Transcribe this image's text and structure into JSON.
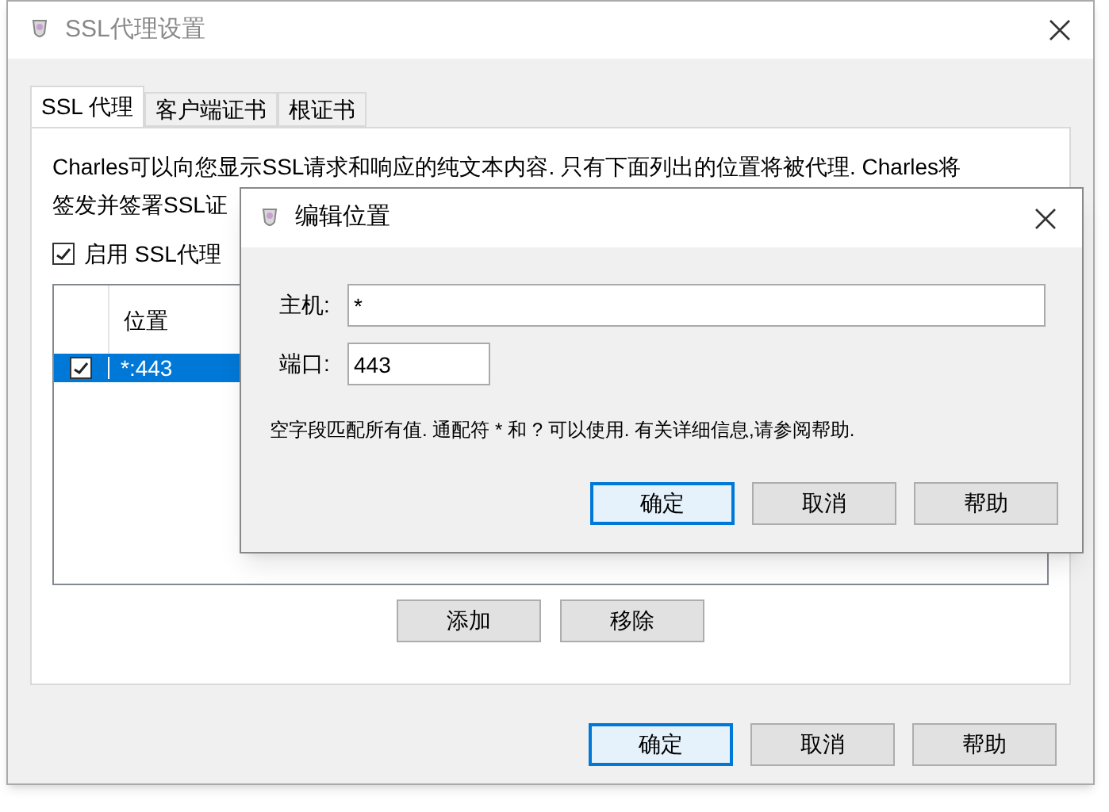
{
  "window": {
    "title": "SSL代理设置",
    "tabs": [
      {
        "label": "SSL 代理",
        "selected": true
      },
      {
        "label": "客户端证书",
        "selected": false
      },
      {
        "label": "根证书",
        "selected": false
      }
    ],
    "description_lines": [
      "Charles可以向您显示SSL请求和响应的纯文本内容. 只有下面列出的位置将被代理. Charles将",
      "签发并签署SSL证"
    ],
    "enable_checkbox": {
      "label": "启用 SSL代理",
      "checked": true
    },
    "table": {
      "columns": [
        "位置"
      ],
      "rows": [
        {
          "checked": true,
          "location": "*:443",
          "selected": true
        }
      ]
    },
    "table_buttons": [
      "添加",
      "移除"
    ],
    "buttons": [
      {
        "label": "确定",
        "default": true
      },
      {
        "label": "取消",
        "default": false
      },
      {
        "label": "帮助",
        "default": false
      }
    ]
  },
  "dialog": {
    "title": "编辑位置",
    "fields": [
      {
        "label": "主机:",
        "value": "*",
        "kind": "wide"
      },
      {
        "label": "端口:",
        "value": "443",
        "kind": "narrow"
      }
    ],
    "hint": "空字段匹配所有值. 通配符 * 和 ? 可以使用. 有关详细信息,请参阅帮助.",
    "buttons": [
      {
        "label": "确定",
        "default": true
      },
      {
        "label": "取消",
        "default": false
      },
      {
        "label": "帮助",
        "default": false
      }
    ]
  }
}
